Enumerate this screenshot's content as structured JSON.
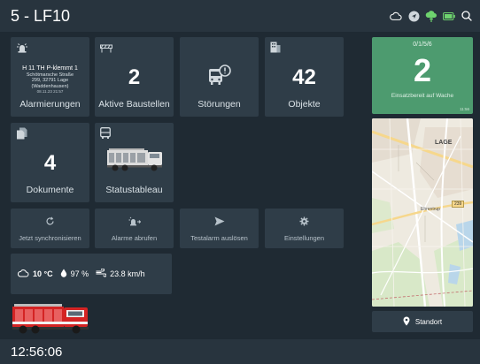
{
  "header": {
    "title": "5 - LF10",
    "icons": [
      "cloud-icon",
      "navigation-icon",
      "cloud-sync-icon",
      "battery-icon",
      "search-icon"
    ]
  },
  "tiles": {
    "alarm": {
      "line1": "H 11 TH P-klemmt 1",
      "line2a": "Schötmarsche Straße",
      "line2b": "299, 32791 Lage",
      "line2c": "(Waddenhausen)",
      "line3": "08.11.23 21:57",
      "label": "Alarmierungen"
    },
    "construction": {
      "value": "2",
      "label": "Aktive Baustellen"
    },
    "faults": {
      "label": "Störungen"
    },
    "objects": {
      "value": "42",
      "label": "Objekte"
    },
    "documents": {
      "value": "4",
      "label": "Dokumente"
    },
    "status_board": {
      "label": "Statustableau"
    }
  },
  "actions": {
    "sync": "Jetzt synchronisieren",
    "fetch": "Alarme abrufen",
    "test": "Testalarm auslösen",
    "settings": "Einstellungen"
  },
  "weather": {
    "temperature": "10 °C",
    "humidity": "97 %",
    "wind": "23.8 km/h"
  },
  "vehicle_status": {
    "code": "0/1/5/6",
    "status": "2",
    "text": "Einsatzbereit auf Wache",
    "time": "11:56"
  },
  "map": {
    "place_label": "LAGE",
    "road_label": "Ehrentrup",
    "road_number": "239"
  },
  "location_button": {
    "label": "Standort"
  },
  "footer": {
    "clock": "12:56:06"
  },
  "colors": {
    "background": "#1f2a33",
    "tile": "#2f3d48",
    "status_green": "#4d9b6f"
  }
}
